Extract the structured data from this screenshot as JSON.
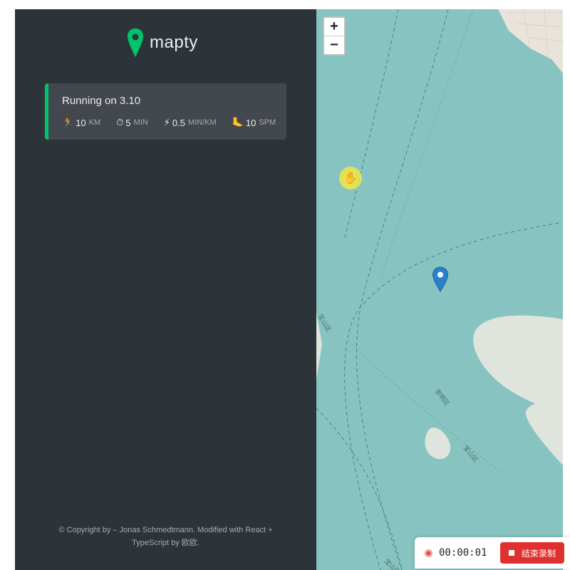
{
  "app": {
    "name": "mapty"
  },
  "workouts": [
    {
      "title": "Running on 3.10",
      "type": "running",
      "accent_color": "#00c46a",
      "details": [
        {
          "icon": "running-icon",
          "glyph": "🏃",
          "value": "10",
          "unit": "KM"
        },
        {
          "icon": "stopwatch-icon",
          "glyph": "⏱",
          "value": "5",
          "unit": "MIN"
        },
        {
          "icon": "lightning-icon",
          "glyph": "⚡",
          "value": "0.5",
          "unit": "MIN/KM"
        },
        {
          "icon": "footprint-icon",
          "glyph": "🦶",
          "value": "10",
          "unit": "SPM"
        }
      ]
    }
  ],
  "footer": {
    "line1": "© Copyright by – Jonas Schmedtmann. Modified with React +",
    "line2": "TypeScript by 欧欧."
  },
  "map": {
    "zoom_in": "+",
    "zoom_out": "−",
    "water_color": "#87c4c1",
    "land_color": "#dfe5dc",
    "marker_color": "#2a81cb",
    "place_labels": [
      "崇明区",
      "宝山区",
      "宝山区",
      "宝山区"
    ]
  },
  "recorder": {
    "time": "00:00:01",
    "stop_label": "结束录制",
    "stop_color": "#e03131"
  }
}
